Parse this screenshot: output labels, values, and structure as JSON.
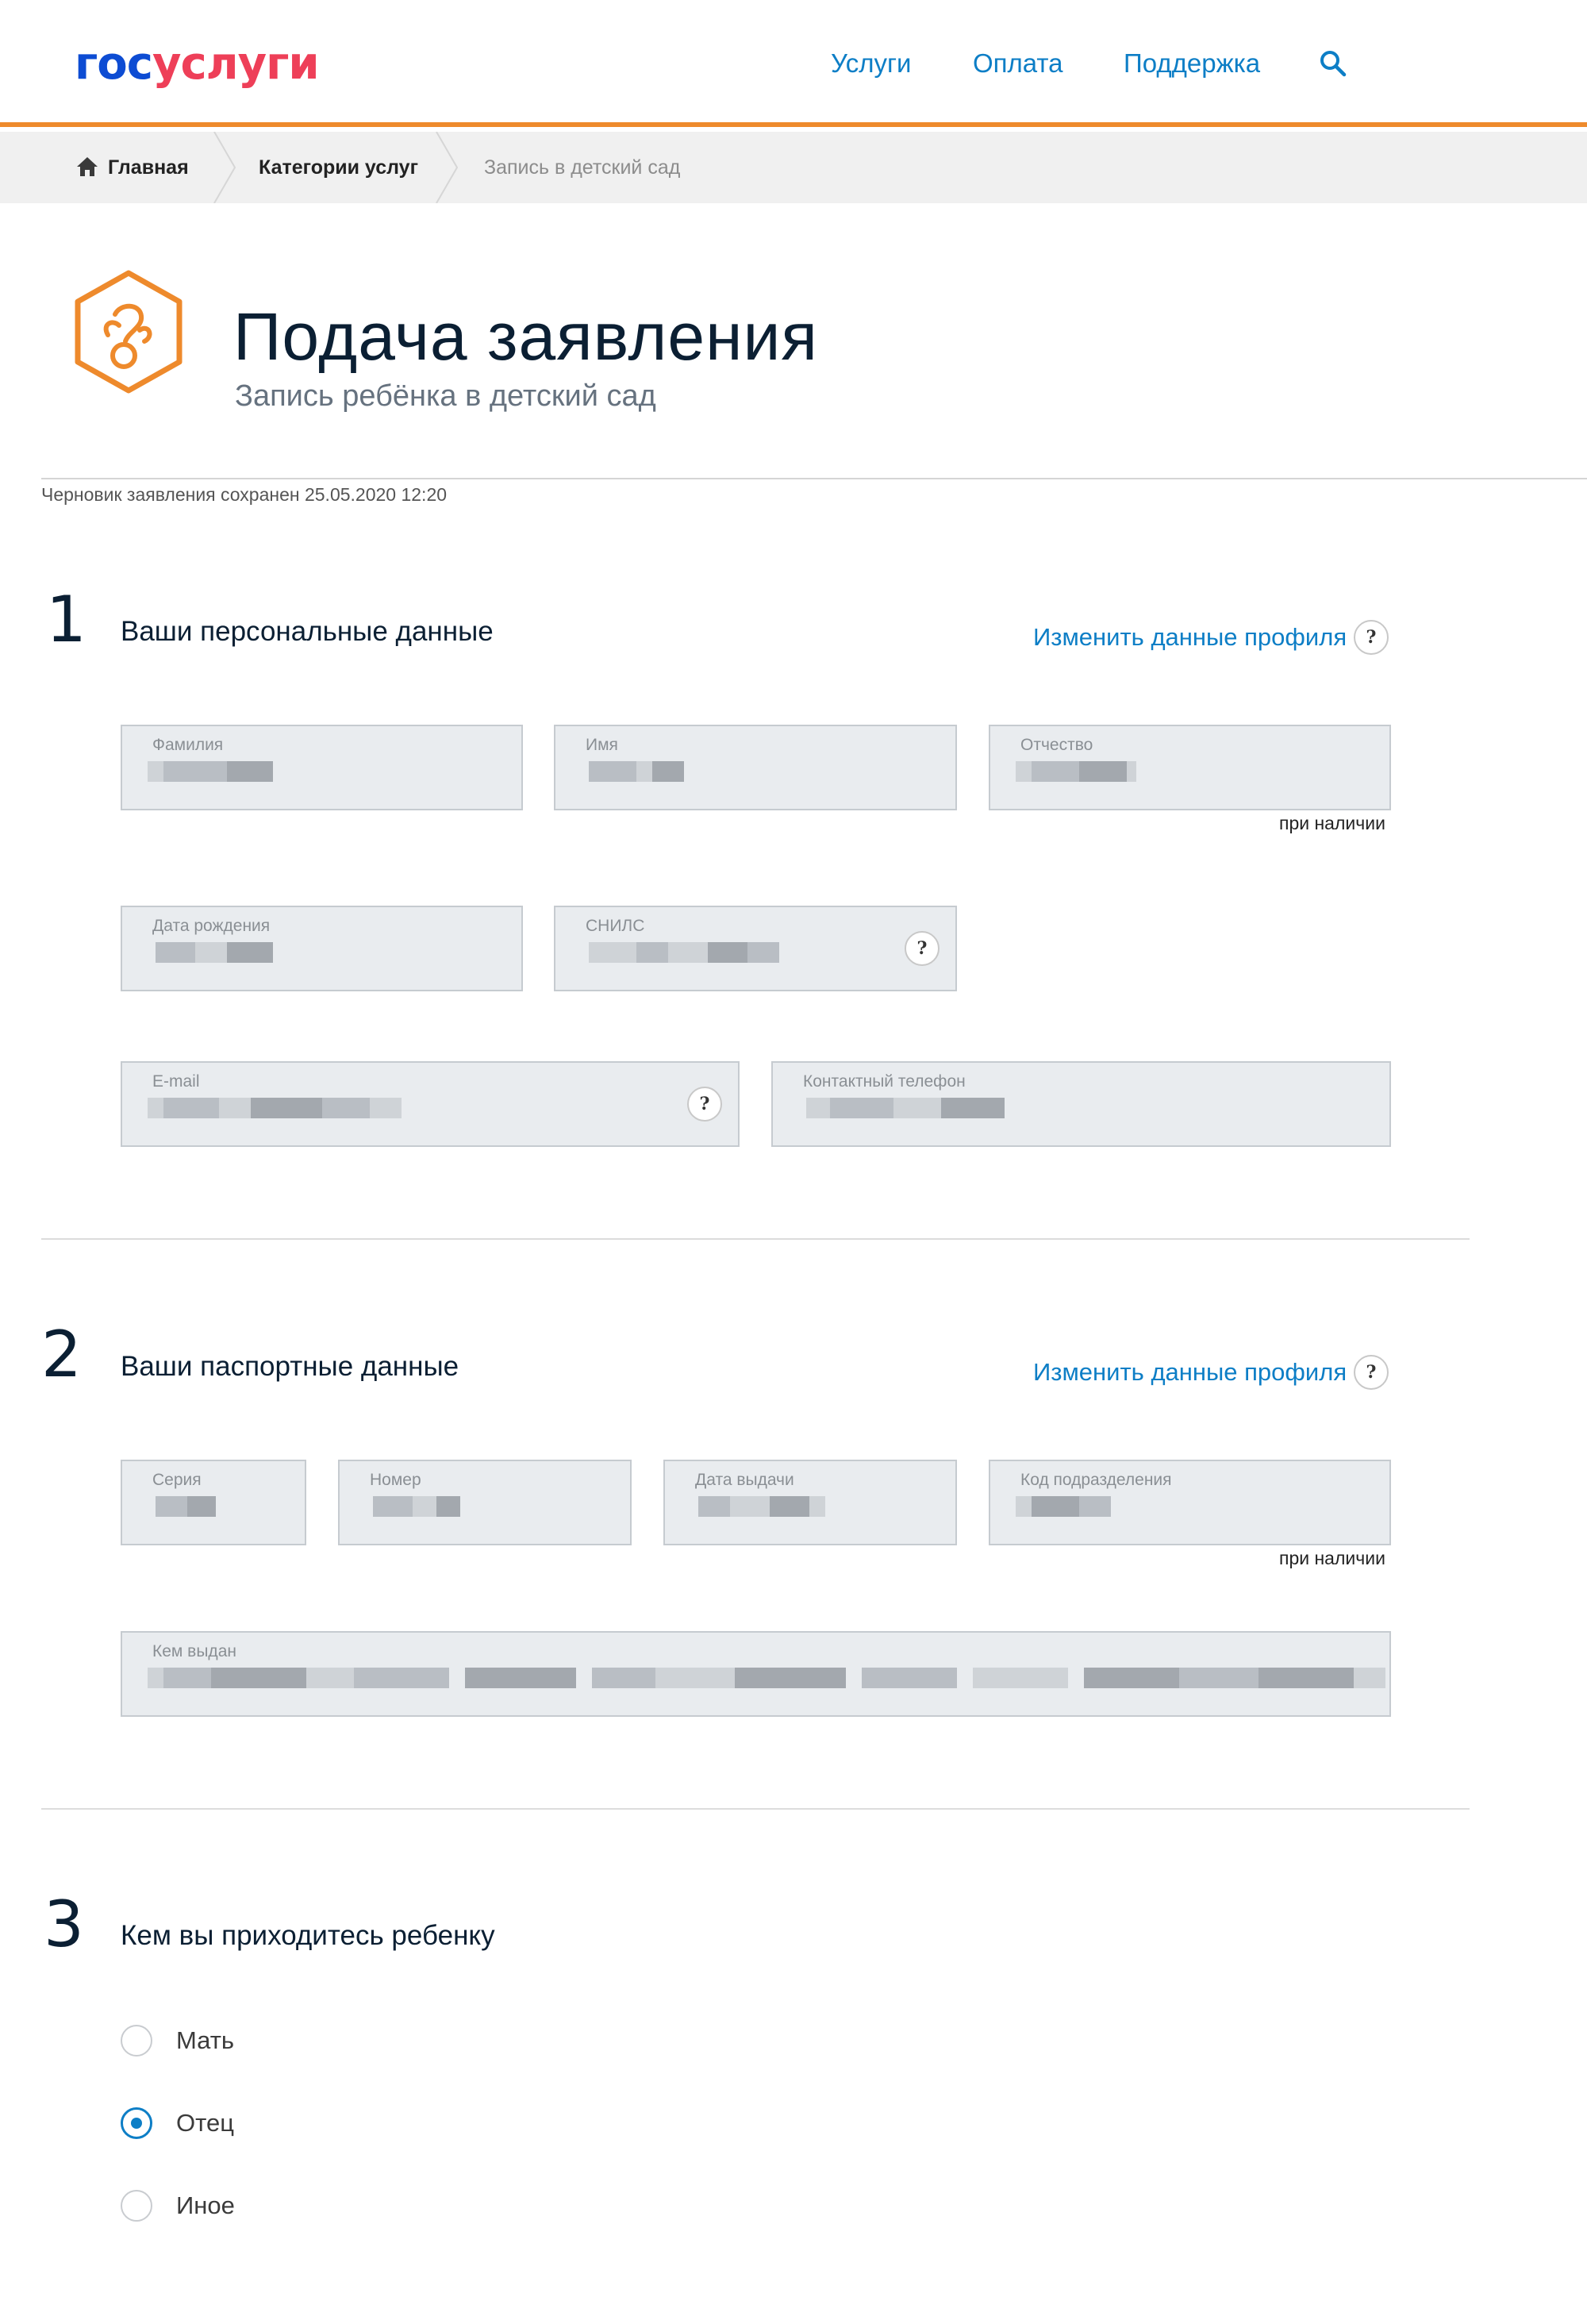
{
  "header": {
    "logo_part1": "гос",
    "logo_part2": "услуги",
    "nav": [
      "Услуги",
      "Оплата",
      "Поддержка"
    ],
    "accent_color": "#ee8a2c"
  },
  "breadcrumb": {
    "home": "Главная",
    "categories": "Категории услуг",
    "current": "Запись в детский сад"
  },
  "page": {
    "title": "Подача заявления",
    "subtitle": "Запись ребёнка в детский сад",
    "draft_status": "Черновик заявления сохранен 25.05.2020 12:20",
    "icon": "pacifier-icon"
  },
  "section1": {
    "number": "1",
    "title": "Ваши персональные данные",
    "edit_link": "Изменить данные профиля",
    "fields": {
      "surname": "Фамилия",
      "name": "Имя",
      "patronymic": "Отчество",
      "birth_date": "Дата рождения",
      "snils": "СНИЛС",
      "email": "E-mail",
      "phone": "Контактный телефон"
    },
    "if_any": "при наличии"
  },
  "section2": {
    "number": "2",
    "title": "Ваши паспортные данные",
    "edit_link": "Изменить данные профиля",
    "fields": {
      "series": "Серия",
      "number": "Номер",
      "issue_date": "Дата выдачи",
      "division_code": "Код подразделения",
      "issued_by": "Кем выдан"
    },
    "if_any": "при наличии"
  },
  "section3": {
    "number": "3",
    "title": "Кем вы приходитесь ребенку",
    "options": [
      "Мать",
      "Отец",
      "Иное"
    ],
    "selected": "Отец"
  },
  "help_symbol": "?"
}
